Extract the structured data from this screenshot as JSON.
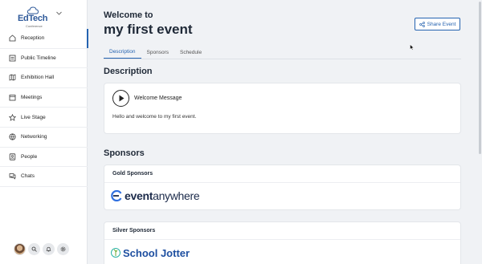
{
  "brand": {
    "name": "EdTech",
    "sub": "Conference"
  },
  "sidebar": {
    "items": [
      {
        "label": "Reception",
        "icon": "home-icon"
      },
      {
        "label": "Public Timeline",
        "icon": "timeline-icon"
      },
      {
        "label": "Exhibition Hall",
        "icon": "map-icon"
      },
      {
        "label": "Meetings",
        "icon": "calendar-icon"
      },
      {
        "label": "Live Stage",
        "icon": "star-icon"
      },
      {
        "label": "Networking",
        "icon": "globe-icon"
      },
      {
        "label": "People",
        "icon": "person-icon"
      },
      {
        "label": "Chats",
        "icon": "chat-icon"
      }
    ],
    "active_index": 0
  },
  "header": {
    "welcome": "Welcome to",
    "title": "my first event",
    "share_label": "Share Event"
  },
  "tabs": [
    {
      "label": "Description",
      "active": true
    },
    {
      "label": "Sponsors",
      "active": false
    },
    {
      "label": "Schedule",
      "active": false
    }
  ],
  "description": {
    "heading": "Description",
    "media_title": "Welcome Message",
    "text": "Hello and welcome to my first event."
  },
  "sponsors": {
    "heading": "Sponsors",
    "gold_heading": "Gold Sponsors",
    "silver_heading": "Silver Sponsors",
    "gold_logo_bold": "event",
    "gold_logo_light": "anywhere",
    "silver_logo_text": "School Jotter"
  },
  "colors": {
    "accent": "#2563b0",
    "background": "#f0f2f5"
  }
}
